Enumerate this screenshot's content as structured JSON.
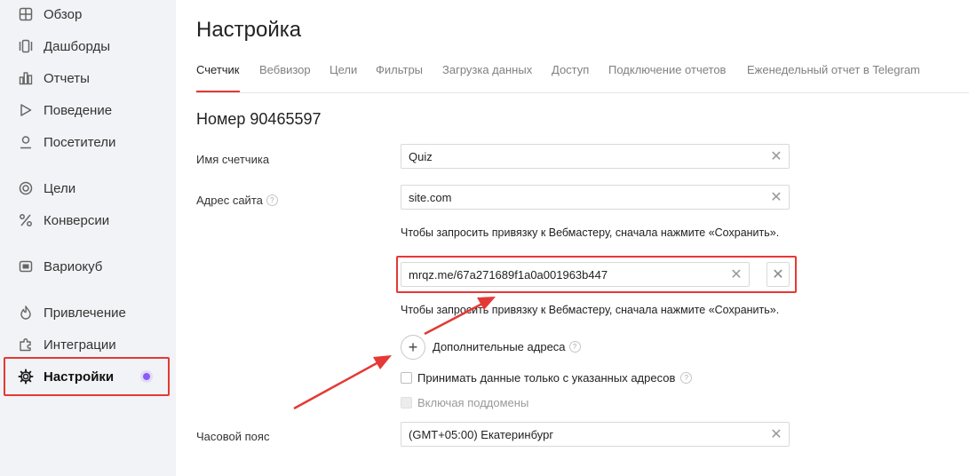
{
  "sidebar": {
    "items": [
      {
        "label": "Обзор",
        "icon": "grid-icon"
      },
      {
        "label": "Дашборды",
        "icon": "dashboards-icon"
      },
      {
        "label": "Отчеты",
        "icon": "bar-chart-icon"
      },
      {
        "label": "Поведение",
        "icon": "play-icon"
      },
      {
        "label": "Посетители",
        "icon": "user-icon"
      },
      {
        "label": "Цели",
        "icon": "target-icon"
      },
      {
        "label": "Конверсии",
        "icon": "percent-icon"
      },
      {
        "label": "Вариокуб",
        "icon": "variocube-icon"
      },
      {
        "label": "Привлечение",
        "icon": "flame-icon"
      },
      {
        "label": "Интеграции",
        "icon": "puzzle-icon"
      },
      {
        "label": "Настройки",
        "icon": "gear-icon",
        "active": true
      }
    ]
  },
  "page": {
    "title": "Настройка",
    "tabs": [
      {
        "label": "Счетчик",
        "active": true
      },
      {
        "label": "Вебвизор"
      },
      {
        "label": "Цели"
      },
      {
        "label": "Фильтры"
      },
      {
        "label": "Загрузка данных"
      },
      {
        "label": "Доступ"
      },
      {
        "label": "Подключение отчетов"
      },
      {
        "label": "Еженедельный отчет в Telegram"
      }
    ],
    "counter_number": "Номер 90465597"
  },
  "form": {
    "counter_name_label": "Имя счетчика",
    "counter_name_value": "Quiz",
    "site_address_label": "Адрес сайта",
    "site_address_value": "site.com",
    "webmaster_hint": "Чтобы запросить привязку к Вебмастеру, сначала нажмите «Сохранить».",
    "additional_address_value": "mrqz.me/67a271689f1a0a001963b447",
    "additional_addresses_label": "Дополнительные адреса",
    "only_listed_addresses_label": "Принимать данные только с указанных адресов",
    "include_subdomains_label": "Включая поддомены",
    "timezone_label": "Часовой пояс",
    "timezone_value": "(GMT+05:00) Екатеринбург"
  },
  "colors": {
    "highlight": "#e53935",
    "accent": "#8a5cf5",
    "sidebar_bg": "#f2f3f6"
  }
}
